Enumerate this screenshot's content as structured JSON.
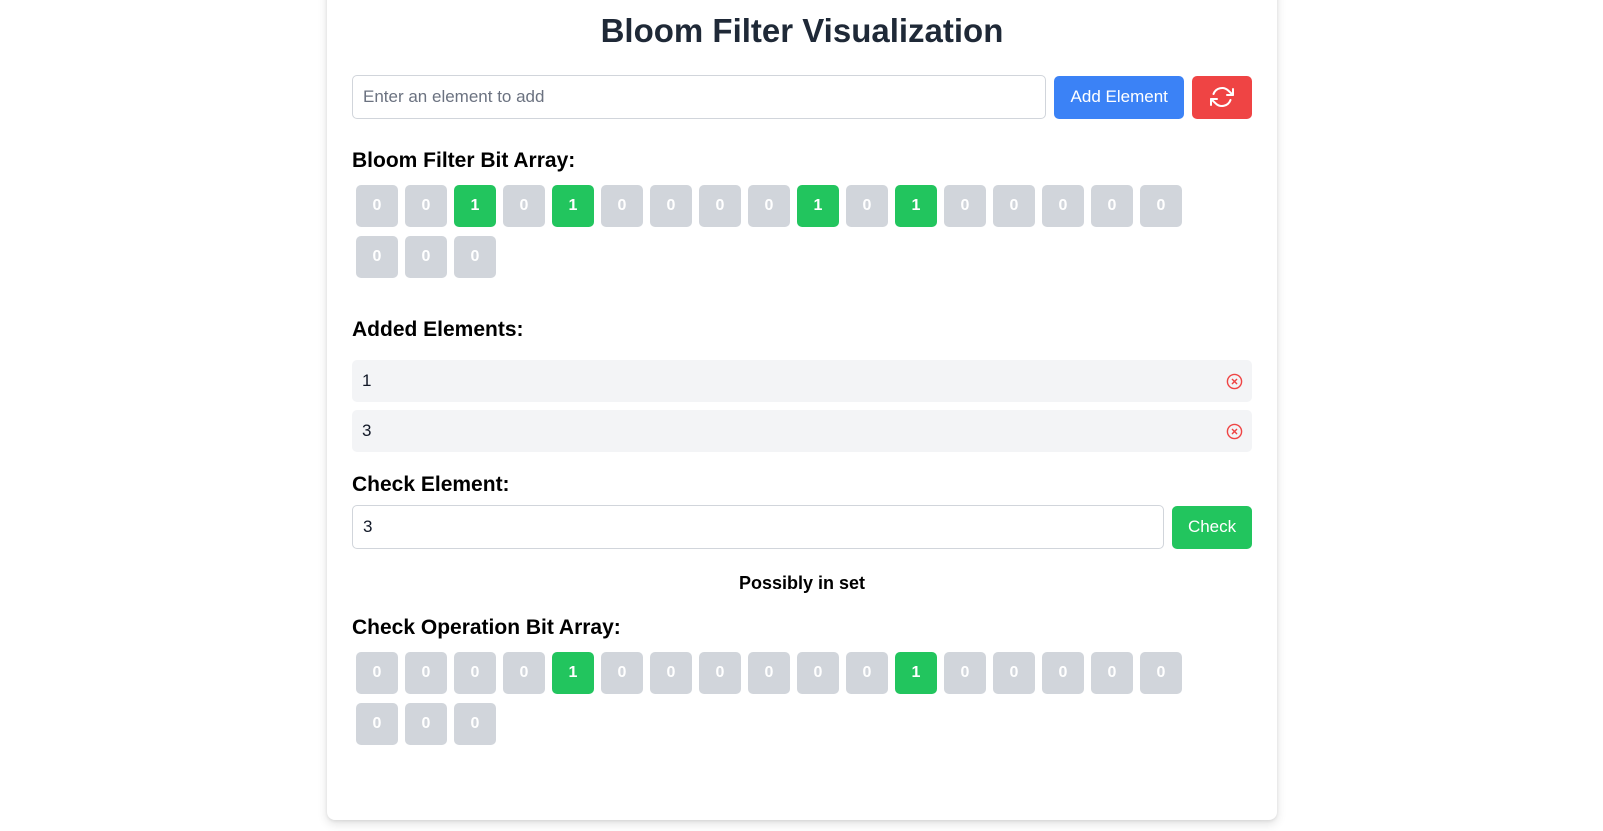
{
  "title": "Bloom Filter Visualization",
  "add_input": {
    "placeholder": "Enter an element to add",
    "value": ""
  },
  "add_button_label": "Add Element",
  "reset_icon": "refresh-icon",
  "bit_array": {
    "title": "Bloom Filter Bit Array:",
    "bits": [
      0,
      0,
      1,
      0,
      1,
      0,
      0,
      0,
      0,
      1,
      0,
      1,
      0,
      0,
      0,
      0,
      0,
      0,
      0,
      0
    ]
  },
  "added_elements": {
    "title": "Added Elements:",
    "items": [
      "1",
      "3"
    ],
    "remove_icon": "x-circle-icon"
  },
  "check": {
    "title": "Check Element:",
    "input_value": "3",
    "button_label": "Check",
    "result": "Possibly in set"
  },
  "check_bit_array": {
    "title": "Check Operation Bit Array:",
    "bits": [
      0,
      0,
      0,
      0,
      1,
      0,
      0,
      0,
      0,
      0,
      0,
      1,
      0,
      0,
      0,
      0,
      0,
      0,
      0,
      0
    ]
  },
  "colors": {
    "bit_on": "#22c55e",
    "bit_off": "#d1d5db",
    "primary": "#3b82f6",
    "danger": "#ef4444",
    "success": "#22c55e"
  }
}
